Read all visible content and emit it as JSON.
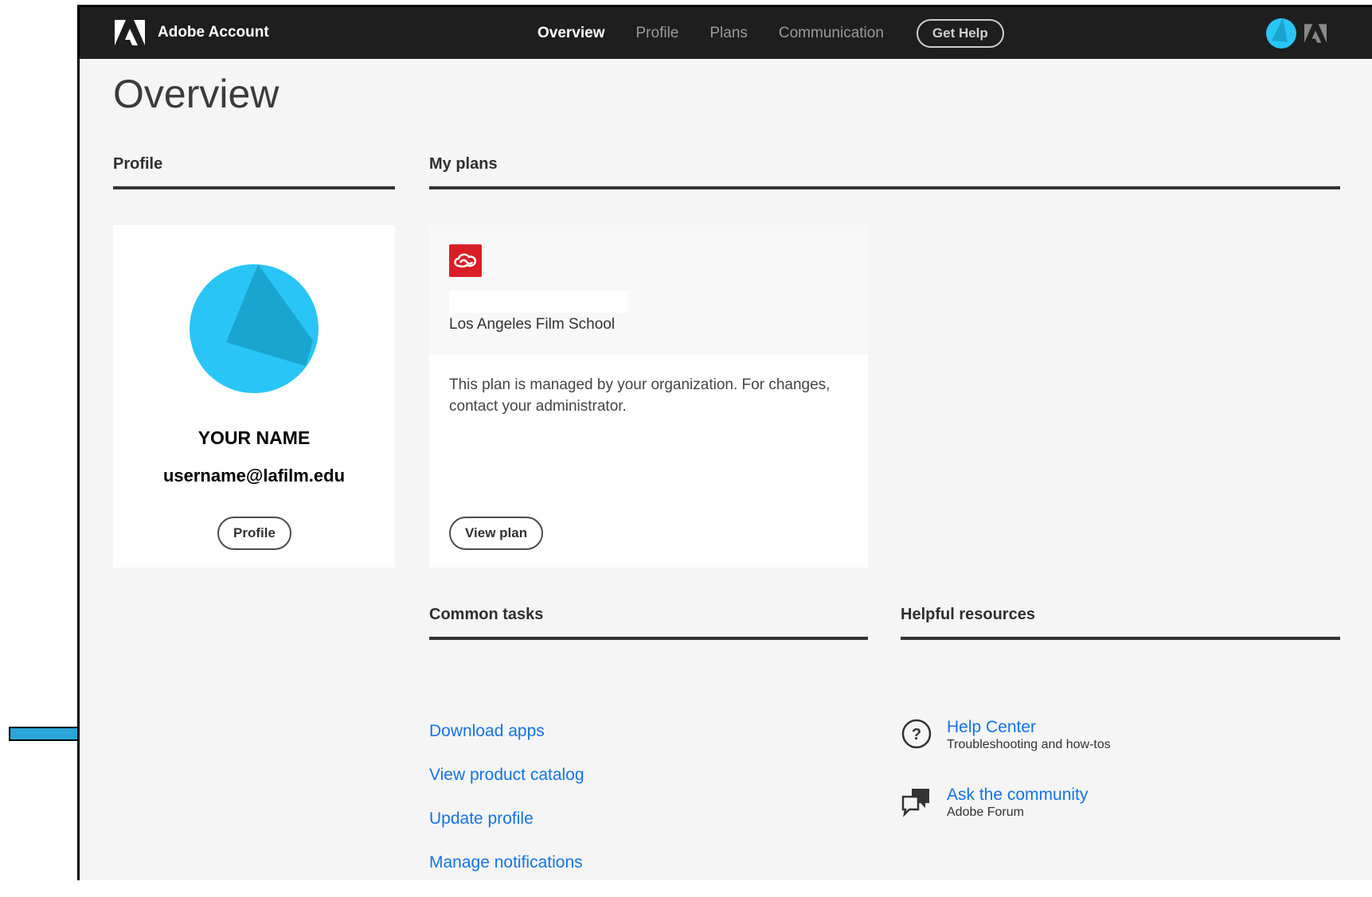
{
  "header": {
    "brand": "Adobe Account",
    "nav": [
      "Overview",
      "Profile",
      "Plans",
      "Communication"
    ],
    "help_button": "Get Help"
  },
  "page": {
    "title": "Overview"
  },
  "profile": {
    "section_title": "Profile",
    "name": "YOUR NAME",
    "email": "username@lafilm.edu",
    "button": "Profile"
  },
  "plans": {
    "section_title": "My plans",
    "organization": "Los Angeles Film School",
    "note": "This plan is managed by your organization. For changes, contact your administrator.",
    "button": "View plan"
  },
  "tasks": {
    "section_title": "Common tasks",
    "links": [
      "Download apps",
      "View product catalog",
      "Update profile",
      "Manage notifications"
    ]
  },
  "resources": {
    "section_title": "Helpful resources",
    "items": [
      {
        "title": "Help Center",
        "subtitle": "Troubleshooting and how-tos",
        "icon": "question-icon"
      },
      {
        "title": "Ask the community",
        "subtitle": "Adobe Forum",
        "icon": "chat-bubbles-icon"
      }
    ]
  },
  "colors": {
    "topbar": "#1e1e1e",
    "link": "#1473e6",
    "avatar": "#29c5f6",
    "creative_cloud": "#d91f26",
    "arrow": "#2aa6d9"
  }
}
